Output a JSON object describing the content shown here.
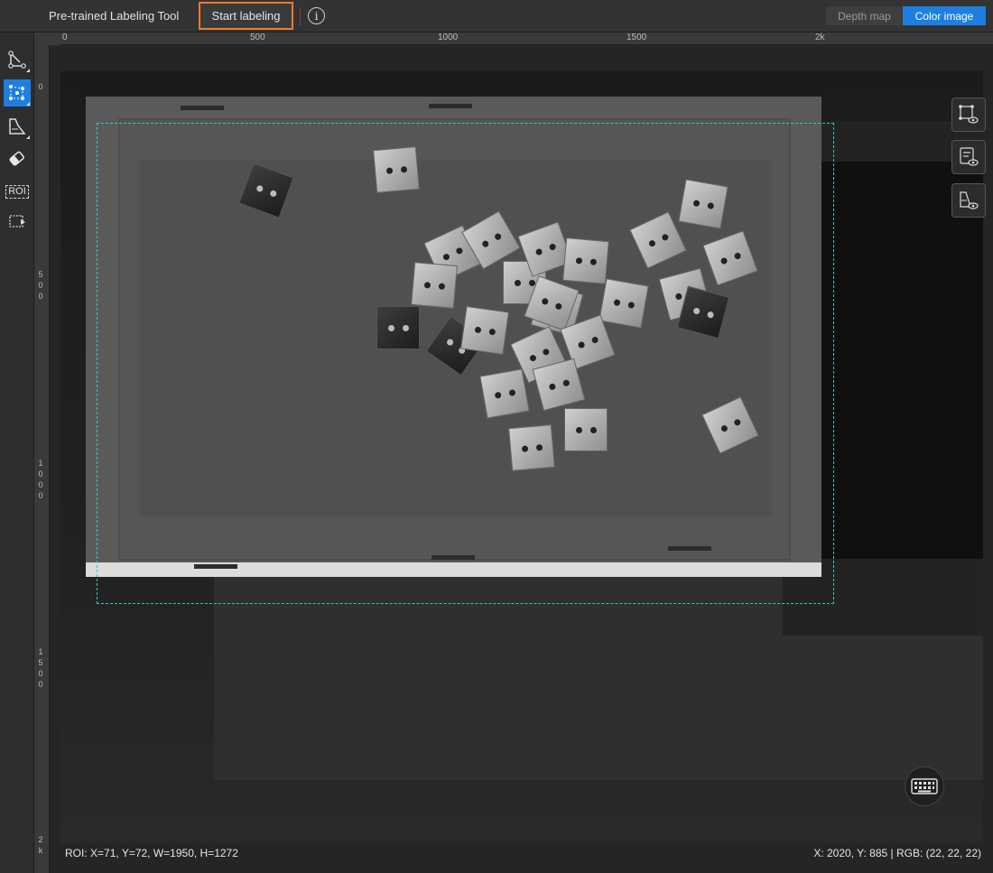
{
  "app": {
    "title": "Pre-trained Labeling Tool",
    "start_button": "Start labeling",
    "info_icon": "info-icon",
    "info_glyph": "i"
  },
  "view_mode": {
    "options": [
      "Depth map",
      "Color image"
    ],
    "selected": "Color image"
  },
  "left_toolbar": {
    "tools": [
      {
        "icon": "polygon-tool-icon",
        "active": false
      },
      {
        "icon": "keypoint-tool-icon",
        "active": true
      },
      {
        "icon": "mask-tool-icon",
        "active": false
      },
      {
        "icon": "eraser-icon",
        "active": false
      },
      {
        "icon": "roi-tool-icon",
        "active": false,
        "label": "ROI"
      },
      {
        "icon": "next-image-icon",
        "active": false
      }
    ]
  },
  "rulers": {
    "horizontal": [
      "0",
      "500",
      "1000",
      "1500",
      "2k"
    ],
    "vertical": [
      "0",
      "500",
      "1000",
      "1500",
      "2k"
    ]
  },
  "right_toolbar": {
    "tools": [
      "show-polygons-icon",
      "show-list-icon",
      "show-masks-icon"
    ]
  },
  "keyboard_button": "keyboard-icon",
  "status": {
    "roi": "ROI: X=71, Y=72, W=1950, H=1272",
    "pixel": "X: 2020, Y: 885 | RGB: (22, 22, 22)"
  },
  "colors": {
    "accent": "#1e7fe0",
    "highlight": "#f07c2a",
    "roi_border": "#39c5c5"
  }
}
